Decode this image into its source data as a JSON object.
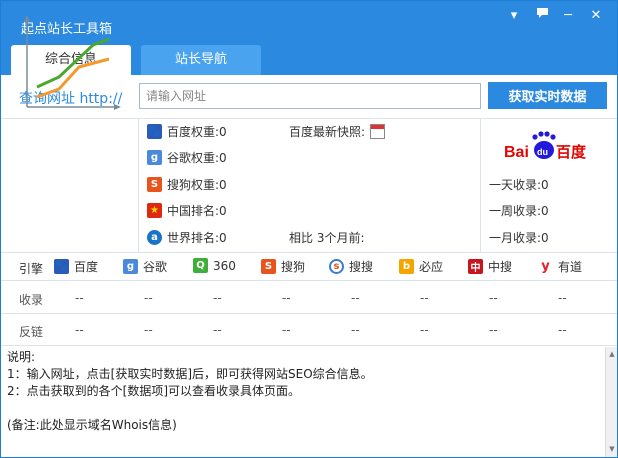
{
  "app": {
    "title": "起点站长工具箱"
  },
  "tabs": [
    {
      "label": "综合信息",
      "active": true
    },
    {
      "label": "站长导航",
      "active": false
    }
  ],
  "query": {
    "label": "查询网址 http://",
    "placeholder": "请输入网址",
    "value": "",
    "button_label": "获取实时数据"
  },
  "ranks": [
    {
      "icon": "baidu-paw-icon",
      "label": "百度权重:0"
    },
    {
      "icon": "google-g-icon",
      "label": "谷歌权重:0"
    },
    {
      "icon": "sogou-s-icon",
      "label": "搜狗权重:0"
    },
    {
      "icon": "china-flag-icon",
      "label": "中国排名:0"
    },
    {
      "icon": "alexa-a-icon",
      "label": "世界排名:0"
    }
  ],
  "snapshot_label": "百度最新快照:",
  "compare_label": "相比 3个月前:",
  "baidu_logo": {
    "text_left": "Bai",
    "text_du": "du",
    "text_right": "百度"
  },
  "index_stats": [
    {
      "label": "一天收录:0"
    },
    {
      "label": "一周收录:0"
    },
    {
      "label": "一月收录:0"
    }
  ],
  "engines_label": "引擎",
  "engines": [
    {
      "name": "百度",
      "icon": "baidu-paw-icon"
    },
    {
      "name": "谷歌",
      "icon": "google-g-icon"
    },
    {
      "name": "360",
      "icon": "so360-search-icon"
    },
    {
      "name": "搜狗",
      "icon": "sogou-s-icon"
    },
    {
      "name": "搜搜",
      "icon": "soso-swirl-icon"
    },
    {
      "name": "必应",
      "icon": "bing-b-icon"
    },
    {
      "name": "中搜",
      "icon": "zhongsou-icon"
    },
    {
      "name": "有道",
      "icon": "youdao-y-icon"
    }
  ],
  "rows": [
    {
      "label": "收录",
      "values": [
        "--",
        "--",
        "--",
        "--",
        "--",
        "--",
        "--",
        "--"
      ]
    },
    {
      "label": "反链",
      "values": [
        "--",
        "--",
        "--",
        "--",
        "--",
        "--",
        "--",
        "--"
      ]
    }
  ],
  "notes": [
    "说明:",
    "1：输入网址，点击[获取实时数据]后，即可获得网站SEO综合信息。",
    "2：点击获取到的各个[数据项]可以查看收录具体页面。",
    "",
    "(备注:此处显示域名Whois信息)"
  ],
  "colors": {
    "accent": "#2b8ae0",
    "tab_inactive": "#49a3ee",
    "trend_green": "#4aa82e",
    "trend_orange": "#f39a2a",
    "baidu_red": "#e10601",
    "baidu_blue": "#2319dc"
  }
}
